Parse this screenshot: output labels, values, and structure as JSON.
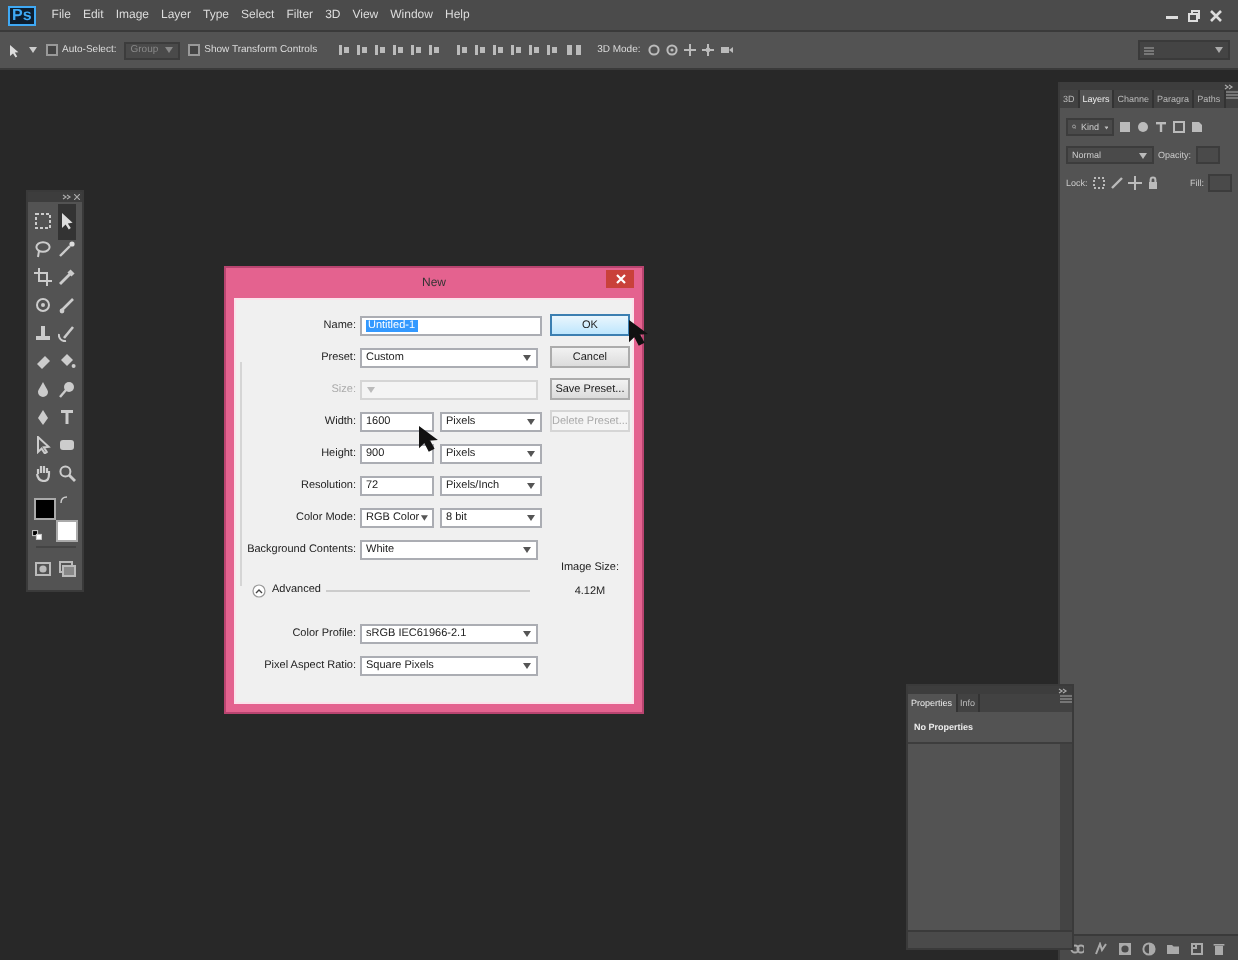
{
  "menu_bar": {
    "logo": "Ps",
    "items": [
      "File",
      "Edit",
      "Image",
      "Layer",
      "Type",
      "Select",
      "Filter",
      "3D",
      "View",
      "Window",
      "Help"
    ]
  },
  "options_bar": {
    "auto_select": {
      "label": "Auto-Select:",
      "checked": false
    },
    "target": {
      "value": "Group",
      "disabled": true
    },
    "show_transform_controls": {
      "label": "Show Transform Controls",
      "checked": false
    },
    "mode_label": "3D Mode:"
  },
  "layers_panel": {
    "tabs": [
      {
        "label": "3D",
        "selected": false
      },
      {
        "label": "Layers",
        "selected": true
      },
      {
        "label": "Channe",
        "selected": false
      },
      {
        "label": "Paragra",
        "selected": false
      },
      {
        "label": "Paths",
        "selected": false
      }
    ],
    "filter": "Kind",
    "blend_mode": "Normal",
    "opacity_label": "Opacity:",
    "lock_label": "Lock:",
    "fill_label": "Fill:"
  },
  "properties_panel": {
    "tabs": [
      {
        "label": "Properties",
        "selected": true
      },
      {
        "label": "Info",
        "selected": false
      }
    ],
    "message": "No Properties"
  },
  "new_dialog": {
    "title": "New",
    "rows": [
      {
        "kind": "text",
        "label": "Name:",
        "value": "Untitled-1",
        "highlighted": true
      },
      {
        "kind": "select",
        "label": "Preset:",
        "value": "Custom"
      },
      {
        "kind": "select",
        "label": "Size:",
        "disabled": true
      },
      {
        "kind": "number",
        "label": "Width:",
        "value": "1600",
        "unit": "Pixels"
      },
      {
        "kind": "number",
        "label": "Height:",
        "value": "900",
        "unit": "Pixels"
      },
      {
        "kind": "number",
        "label": "Resolution:",
        "value": "72",
        "unit": "Pixels/Inch"
      },
      {
        "kind": "dual",
        "label": "Color Mode:",
        "value": "RGB Color",
        "unit": "8 bit"
      },
      {
        "kind": "select",
        "label": "Background Contents:",
        "value": "White"
      },
      {
        "kind": "section",
        "label": "Advanced",
        "expanded": true
      },
      {
        "kind": "select",
        "label": "Color Profile:",
        "value": "sRGB IEC61966-2.1"
      },
      {
        "kind": "select",
        "label": "Pixel Aspect Ratio:",
        "value": "Square Pixels"
      }
    ],
    "buttons": [
      {
        "label": "OK",
        "default": true,
        "disabled": false
      },
      {
        "label": "Cancel",
        "default": false,
        "disabled": false
      },
      {
        "label": "Save Preset...",
        "default": false,
        "disabled": false
      },
      {
        "label": "Delete Preset...",
        "default": false,
        "disabled": true
      }
    ],
    "image_size": {
      "label": "Image Size:",
      "value": "4.12M"
    }
  }
}
